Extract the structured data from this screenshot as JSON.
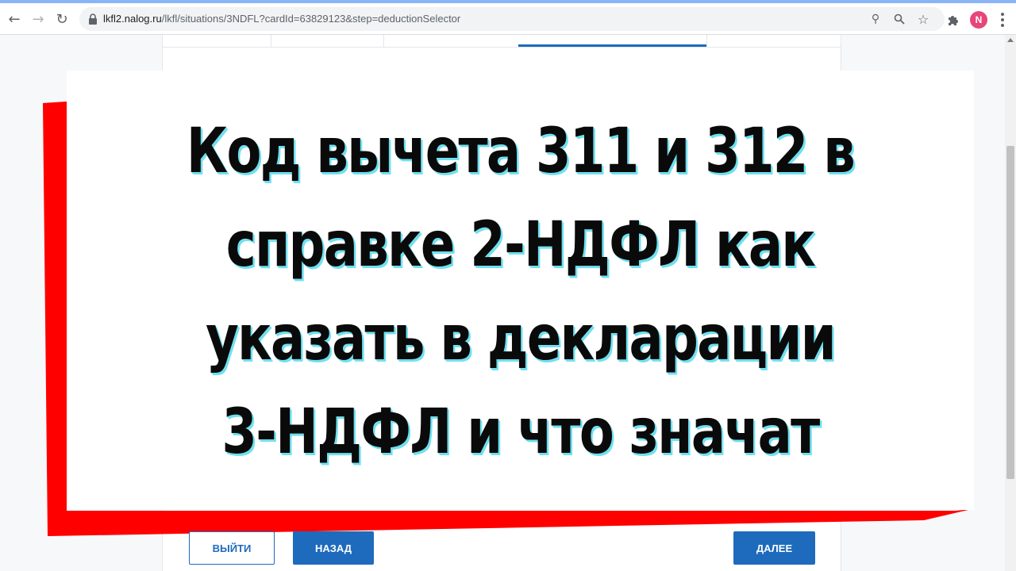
{
  "browser": {
    "url_host": "lkfl2.nalog.ru",
    "url_path": "/lkfl/situations/3NDFL?cardId=63829123&step=deductionSelector",
    "profile_initial": "N",
    "icons": {
      "back": "arrow-left-icon",
      "forward": "arrow-right-icon",
      "reload": "reload-icon",
      "lock": "lock-icon",
      "key": "key-icon",
      "zoom": "zoom-icon",
      "star": "star-icon",
      "extensions": "puzzle-icon",
      "menu": "kebab-menu-icon"
    }
  },
  "page": {
    "buttons": {
      "exit": "ВЫЙТИ",
      "back": "НАЗАД",
      "next": "ДАЛЕЕ"
    }
  },
  "overlay": {
    "headline_lines": [
      "Код вычета 311 и 312 в",
      "справке 2-НДФЛ как",
      "указать в декларации",
      "3-НДФЛ и что значат"
    ]
  },
  "colors": {
    "accent": "#1e6bbd",
    "frame_red": "#ff0000",
    "text_shadow": "#6fe0f0"
  }
}
